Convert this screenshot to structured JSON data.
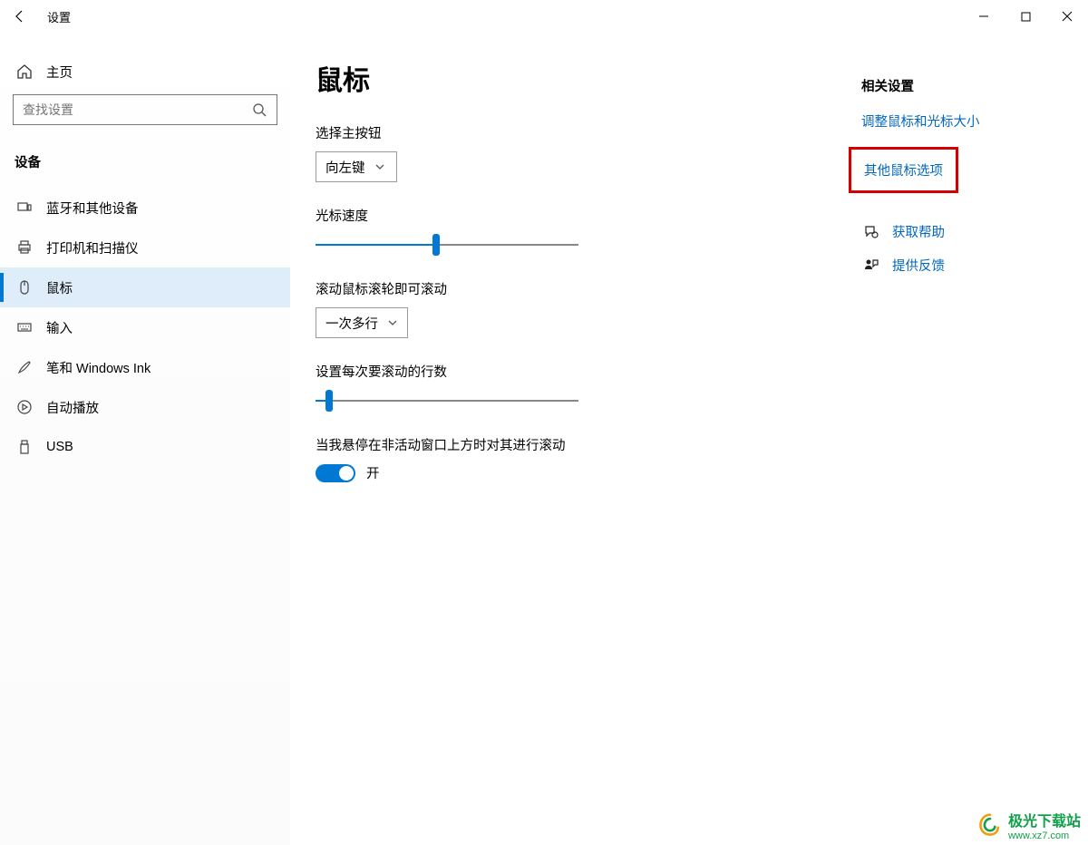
{
  "window": {
    "title": "设置"
  },
  "sidebar": {
    "home_label": "主页",
    "search_placeholder": "查找设置",
    "section_title": "设备",
    "items": [
      {
        "label": "蓝牙和其他设备"
      },
      {
        "label": "打印机和扫描仪"
      },
      {
        "label": "鼠标"
      },
      {
        "label": "输入"
      },
      {
        "label": "笔和 Windows Ink"
      },
      {
        "label": "自动播放"
      },
      {
        "label": "USB"
      }
    ],
    "selected_index": 2
  },
  "main": {
    "page_title": "鼠标",
    "primary_button": {
      "label": "选择主按钮",
      "value": "向左键"
    },
    "cursor_speed": {
      "label": "光标速度",
      "value": 46
    },
    "scroll_mode": {
      "label": "滚动鼠标滚轮即可滚动",
      "value": "一次多行"
    },
    "lines_per_scroll": {
      "label": "设置每次要滚动的行数",
      "value": 5
    },
    "inactive_window_scroll": {
      "label": "当我悬停在非活动窗口上方时对其进行滚动",
      "state_text": "开",
      "on": true
    }
  },
  "related": {
    "heading": "相关设置",
    "links": [
      {
        "text": "调整鼠标和光标大小"
      },
      {
        "text": "其他鼠标选项"
      }
    ],
    "help_link": "获取帮助",
    "feedback_link": "提供反馈"
  },
  "watermark": {
    "brand": "极光下载站",
    "url": "www.xz7.com"
  }
}
